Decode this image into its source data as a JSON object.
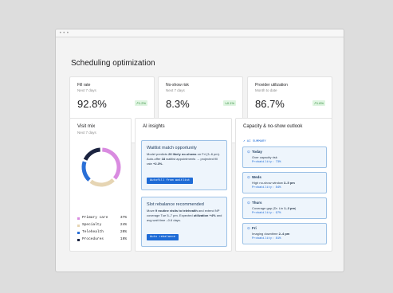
{
  "window": {
    "dots": "•••"
  },
  "page": {
    "title": "Scheduling optimization"
  },
  "kpis": [
    {
      "label": "Fill rate",
      "sub": "Next 7 days",
      "value": "92.8%",
      "delta": "↗1.2%"
    },
    {
      "label": "No-show risk",
      "sub": "Next 7 days",
      "value": "8.3%",
      "delta": "↘0.1%"
    },
    {
      "label": "Provider utilization",
      "sub": "Month to date",
      "value": "86.7%",
      "delta": "↗1.6%"
    }
  ],
  "visit_mix": {
    "title": "Visit mix",
    "sub": "Next 7 days",
    "items": [
      {
        "label": "Primary care",
        "pct": "37%",
        "value": 37,
        "color": "#d98be0"
      },
      {
        "label": "Specialty",
        "pct": "24%",
        "value": 24,
        "color": "#e6d5b3"
      },
      {
        "label": "Telehealth",
        "pct": "20%",
        "value": 20,
        "color": "#2a6fd6"
      },
      {
        "label": "Procedures",
        "pct": "19%",
        "value": 19,
        "color": "#1b2340"
      }
    ]
  },
  "ai_insights": {
    "title": "AI insights",
    "cards": [
      {
        "title": "Waitlist match opportunity",
        "body_parts": [
          {
            "t": "Model predicts ",
            "b": false
          },
          {
            "t": "26 likely no-shows",
            "b": true
          },
          {
            "t": " on Fri (3–6 pm). Auto-offer ",
            "b": false
          },
          {
            "t": "18",
            "b": true
          },
          {
            "t": " waitlist appointments → projected fill rate ",
            "b": false
          },
          {
            "t": "+2.3%",
            "b": true
          },
          {
            "t": ".",
            "b": false
          }
        ],
        "button": "Autofill from waitlist"
      },
      {
        "title": "Slot rebalance recommended",
        "body_parts": [
          {
            "t": "Move ",
            "b": false
          },
          {
            "t": "9 routine visits to telehealth",
            "b": true
          },
          {
            "t": " and extend NP coverage Tue 5–7 pm. Expected ",
            "b": false
          },
          {
            "t": "utilization +4%",
            "b": true
          },
          {
            "t": " and avg wait time –0.6 days.",
            "b": false
          }
        ],
        "button": "Auto rebalance"
      }
    ]
  },
  "capacity": {
    "title": "Capacity & no-show outlook",
    "summary_label": "↗ AI SUMMARY",
    "days": [
      {
        "icon": "⊙",
        "name": "Today",
        "desc_parts": [
          {
            "t": "Over capacity risk",
            "b": false
          }
        ],
        "prob": "Probability: 73%"
      },
      {
        "icon": "⊙",
        "name": "Weds",
        "desc_parts": [
          {
            "t": "High no-show window ",
            "b": false
          },
          {
            "t": "3–5 pm",
            "b": true
          }
        ],
        "prob": "Probability: 84%"
      },
      {
        "icon": "⊙",
        "name": "Thurs",
        "desc_parts": [
          {
            "t": "Coverage gap (Dr. Lin ",
            "b": false
          },
          {
            "t": "1–3 pm",
            "b": true
          },
          {
            "t": ")",
            "b": false
          }
        ],
        "prob": "Probability: 97%"
      },
      {
        "icon": "⊙",
        "name": "Fri",
        "desc_parts": [
          {
            "t": "Imaging downtime ",
            "b": false
          },
          {
            "t": "2–4 pm",
            "b": true
          }
        ],
        "prob": "Probability: 81%"
      }
    ]
  }
}
